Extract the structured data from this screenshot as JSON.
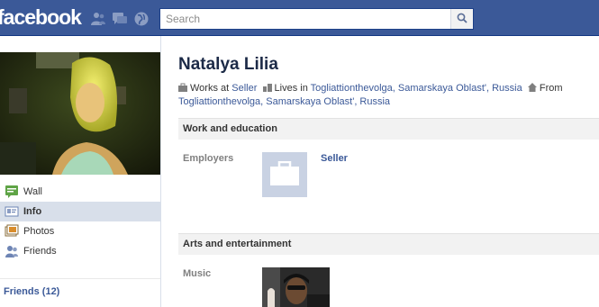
{
  "header": {
    "logo": "facebook",
    "search_placeholder": "Search",
    "jewels": [
      "friend-requests-icon",
      "messages-icon",
      "notifications-icon"
    ],
    "search_icon": "magnifier-icon",
    "colors": {
      "bar": "#3b5998",
      "link": "#3b5998",
      "nav_active": "#d8dfea"
    }
  },
  "sidebar": {
    "items": [
      {
        "label": "Wall",
        "icon": "wall-icon",
        "active": false
      },
      {
        "label": "Info",
        "icon": "info-icon",
        "active": true
      },
      {
        "label": "Photos",
        "icon": "photos-icon",
        "active": false
      },
      {
        "label": "Friends",
        "icon": "friends-icon",
        "active": false
      }
    ],
    "friends_link": "Friends (12)"
  },
  "profile": {
    "name": "Natalya Lilia",
    "works_at_prefix": "Works at",
    "employer": "Seller",
    "lives_in_prefix": "Lives in",
    "lives_in": "Togliattionthevolga, Samarskaya Oblast', Russia",
    "from_prefix": "From",
    "from": "Togliattionthevolga, Samarskaya Oblast', Russia"
  },
  "sections": {
    "work": {
      "title": "Work and education",
      "employers_label": "Employers",
      "employer_name": "Seller",
      "employer_icon": "briefcase-icon"
    },
    "arts": {
      "title": "Arts and entertainment",
      "music_label": "Music"
    }
  }
}
